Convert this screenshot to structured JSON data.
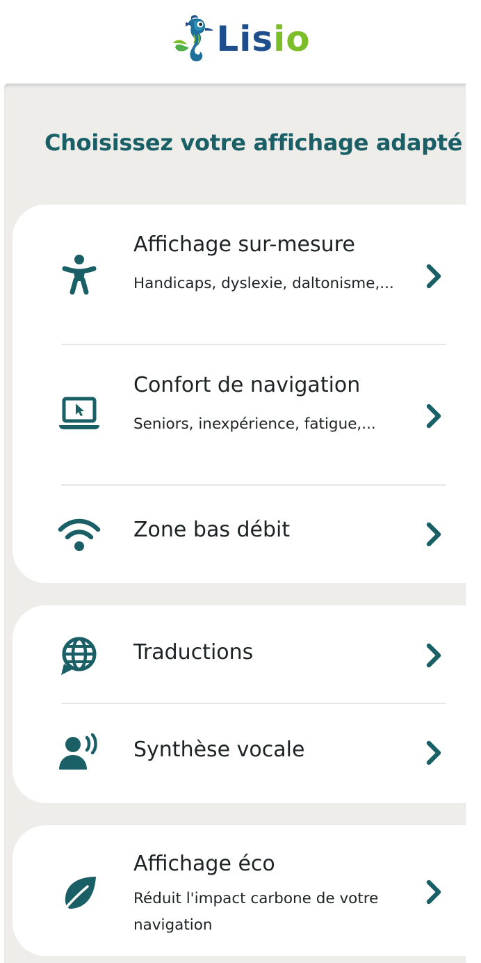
{
  "brand": {
    "name_part1": "Lis",
    "name_part2": "io",
    "icon": "seahorse-logo-icon",
    "colors": {
      "blue": "#1e4f8c",
      "green": "#7cbd2a",
      "teal": "#1a5f66"
    }
  },
  "page_title": "Choisissez votre affichage adapté",
  "groups": [
    {
      "items": [
        {
          "icon": "accessibility-person-icon",
          "title": "Affichage sur-mesure",
          "subtitle": "Handicaps, dyslexie, daltonisme,..."
        },
        {
          "icon": "laptop-cursor-icon",
          "title": "Confort de navigation",
          "subtitle": "Seniors, inexpérience, fatigue,..."
        },
        {
          "icon": "wifi-icon",
          "title": "Zone bas débit",
          "subtitle": ""
        }
      ]
    },
    {
      "items": [
        {
          "icon": "globe-chat-icon",
          "title": "Traductions",
          "subtitle": ""
        },
        {
          "icon": "person-speaking-icon",
          "title": "Synthèse vocale",
          "subtitle": ""
        }
      ]
    },
    {
      "items": [
        {
          "icon": "leaf-icon",
          "title": "Affichage éco",
          "subtitle": "Réduit l'impact carbone de votre navigation"
        }
      ]
    }
  ],
  "chevron_icon": "chevron-right-icon",
  "colors": {
    "panel_background": "#eeedea",
    "card_background": "#ffffff",
    "icon_color": "#1a5f66",
    "text_color": "#1d2324"
  }
}
